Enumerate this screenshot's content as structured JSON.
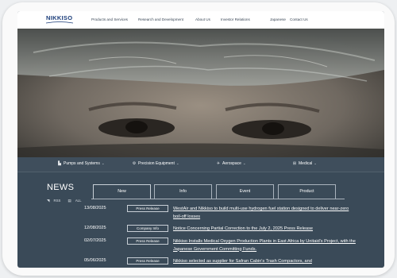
{
  "header": {
    "logo": "NIKKISO",
    "nav": [
      "Products and Services",
      "Research and Development",
      "About Us",
      "Investor Relations",
      "Japanese",
      "Contact Us"
    ]
  },
  "categories": [
    {
      "label": "Pumps and Systems",
      "icon": "pump-icon"
    },
    {
      "label": "Precision Equipment",
      "icon": "precision-icon"
    },
    {
      "label": "Aerospace",
      "icon": "airplane-icon"
    },
    {
      "label": "Medical",
      "icon": "medical-icon"
    }
  ],
  "news": {
    "heading": "NEWS",
    "rss": "RSS",
    "all": "ALL",
    "tabs": [
      "New",
      "Info",
      "Event",
      "Product"
    ],
    "active_tab": "New",
    "items": [
      {
        "date": "13/08/2025",
        "tag": "Press Release",
        "title": "WestAir and Nikkiso to build multi-use hydrogen fuel station designed to deliver near-zero boil-off losses"
      },
      {
        "date": "12/08/2025",
        "tag": "Company Info",
        "title": "Notice Concerning Partial Correction to the July 2, 2025 Press Release"
      },
      {
        "date": "02/07/2025",
        "tag": "Press Release",
        "title": "Nikkiso Installs Medical Oxygen Production Plants in East Africa by Unitaid's Project, with the Japanese Government Committing Funds."
      },
      {
        "date": "05/06/2025",
        "tag": "Press Release",
        "title": "Nikkiso selected as supplier for Safran Cabin's Trash Compactors, and"
      }
    ]
  },
  "colors": {
    "brand": "#1b3d7a",
    "panel": "#3a4a58"
  }
}
